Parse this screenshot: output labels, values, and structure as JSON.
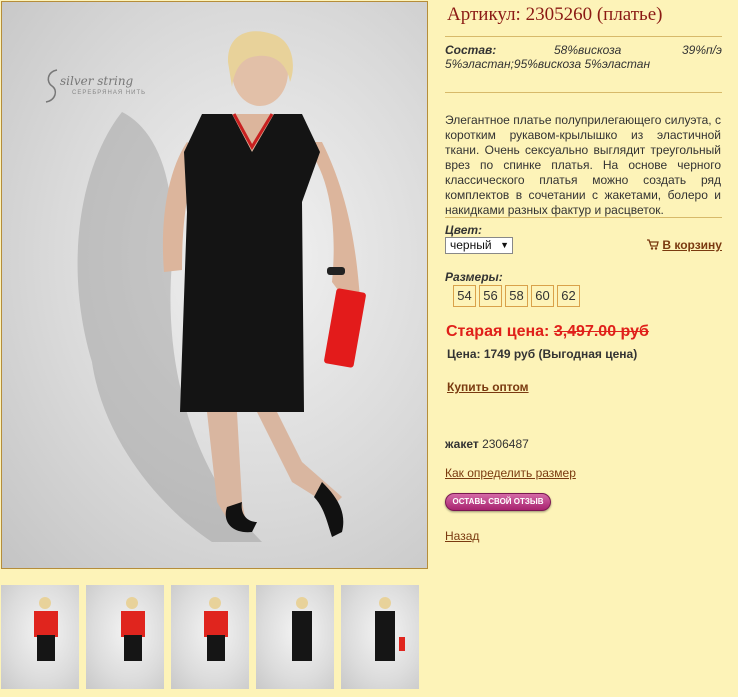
{
  "product": {
    "title": "Артикул: 2305260 (платье)",
    "composition_label": "Состав:",
    "composition_a": "58%вискоза",
    "composition_b": "39%п/э",
    "composition_c": "5%эластан;95%вискоза 5%эластан",
    "description": "Элегантное платье полуприлегающего силуэта, с коротким рукавом-крылышко из эластичной ткани. Очень сексуально выглядит треугольный врез по спинке платья. На основе черного классического платья можно создать ряд комплектов в сочетании с жакетами, болеро и накидками разных фактур и расцветок."
  },
  "logo": {
    "text": "silver string",
    "sub": "СЕРЕБРЯНАЯ НИТЬ"
  },
  "color": {
    "label": "Цвет:",
    "selected": "черный"
  },
  "cart": {
    "label": "В корзину"
  },
  "sizes": {
    "label": "Размеры:",
    "items": [
      "54",
      "56",
      "58",
      "60",
      "62"
    ]
  },
  "price": {
    "old_label": "Старая цена: ",
    "old_value": "3,497.00 руб",
    "current": "Цена: 1749 руб (Выгодная цена)"
  },
  "links": {
    "wholesale": "Купить оптом",
    "size_guide": "Как определить размер",
    "back": "Назад"
  },
  "jacket": {
    "label": "жакет",
    "code": "2306487"
  },
  "review_button": "ОСТАВЬ СВОЙ ОТЗЫВ",
  "colors": {
    "accent": "#8b1a14",
    "price_red": "#e0201a",
    "background": "#fdf3b8"
  }
}
